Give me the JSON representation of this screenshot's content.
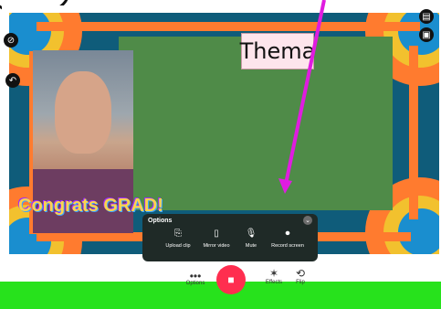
{
  "stage": {
    "name_tag": "Thema",
    "sticker": "Congrats GRAD!"
  },
  "options": {
    "title": "Options",
    "items": [
      {
        "label": "Upload clip",
        "icon": "upload-clip-icon"
      },
      {
        "label": "Mirror video",
        "icon": "mirror-video-icon"
      },
      {
        "label": "Mute",
        "icon": "microphone-icon"
      },
      {
        "label": "Record screen",
        "icon": "record-screen-icon"
      }
    ]
  },
  "toolbar": {
    "options_label": "Options",
    "effects_label": "Effects",
    "flip_label": "Flip"
  },
  "colors": {
    "accent_pink": "#ff2e4f",
    "annotation_magenta": "#e01ce0",
    "highlight_green": "#27e21c"
  }
}
